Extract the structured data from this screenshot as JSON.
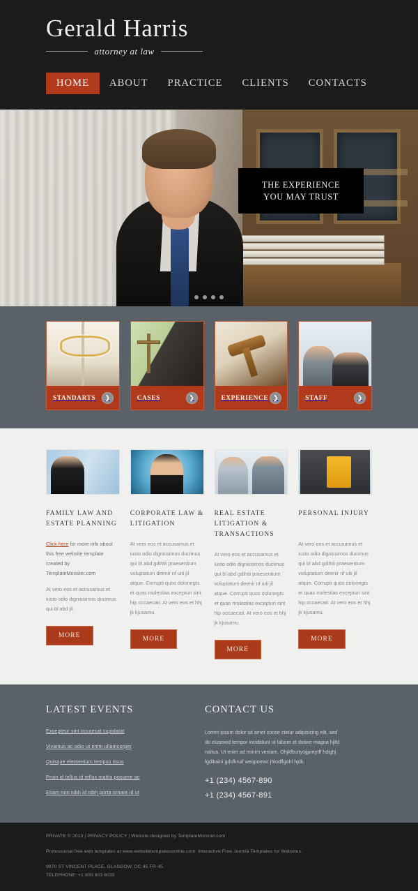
{
  "header": {
    "brand_name": "Gerald Harris",
    "brand_tagline": "attorney at law",
    "nav": [
      {
        "label": "HOME",
        "active": true
      },
      {
        "label": "ABOUT",
        "active": false
      },
      {
        "label": "PRACTICE",
        "active": false
      },
      {
        "label": "CLIENTS",
        "active": false
      },
      {
        "label": "CONTACTS",
        "active": false
      }
    ]
  },
  "hero": {
    "caption_line1": "THE EXPERIENCE",
    "caption_line2": "YOU MAY TRUST",
    "slide_count": 4,
    "active_slide": 1
  },
  "cards": [
    {
      "title": "STANDARTS",
      "arrow_icon": "chevron-right-icon"
    },
    {
      "title": "CASES",
      "arrow_icon": "chevron-right-icon"
    },
    {
      "title": "EXPERIENCE",
      "arrow_icon": "chevron-right-icon"
    },
    {
      "title": "STAFF",
      "arrow_icon": "chevron-right-icon"
    }
  ],
  "content": {
    "columns": [
      {
        "heading": "FAMILY LAW AND ESTATE PLANNING",
        "link_text": "Click here",
        "link_tail": " for more info about this free website template created by TemplateMonster.com",
        "body": "At vero eos et accusamus et iusto odio dignissimos ducimus qui bl abd jil.",
        "button": "MORE"
      },
      {
        "heading": "CORPORATE LAW & LITIGATION",
        "body": "At vero eos et accusamus et iusto odio dignissimos ducimus qui bl abd gdihtii praesentium voluptatum deenir nf uiti jil atque. Corrupti quos dolonegts et quas molestias excepturi sint hip occaecati. At vero eos et hhj jk kjusamu.",
        "button": "MORE"
      },
      {
        "heading": "REAL ESTATE LITIGATION & TRANSACTIONS",
        "body": "At vero eos et accusamus et iusto odio dignissimos ducimus qui bl abd gdihtii praesentium voluptatum deenir nf uiti jil atque. Corrupti quos dolonegts et quas molestias excepturi sint hip occaecati. At vero eos et hhj jk kjusamu.",
        "button": "MORE"
      },
      {
        "heading": "PERSONAL INJURY",
        "body": "At vero eos et accusamus et iusto odio dignissimos ducimus qui bl abd gdihtii praesentium voluptatum deenir nf uiti jil atque. Corrupti quos dolonegts et quas molestias excepturi sint hip occaecati. At vero eos et hhj jk kjusamu.",
        "button": "MORE"
      }
    ]
  },
  "footer": {
    "events_heading": "LATEST EVENTS",
    "events": [
      "Excepteur sint occaecat cupidatat",
      "Vivamus ac odio ut enim ullamcorper",
      "Quisque elementum tempus risus",
      "Proin id tellus id tellus mattis posuere ac",
      "Etiam non nibh id nibh porta ornare id ut"
    ],
    "contact_heading": "CONTACT US",
    "contact_text": "Lorem ipsum dolor sit amet conse ctetur adipisicing elit, sed do eiusmod tempor incididunt ut labore et dolore magna hjifd naliua. Ut enim ad minim veniam. Ohjkfbuityojjpreytff hdighj fgdlkaioi gdsfkruif weqpomvc jhlodflgohl hjdk.",
    "phone_1": "+1 (234) 4567-890",
    "phone_2": "+1 (234) 4567-891"
  },
  "bottom": {
    "copyright": "PRIVATE © 2013 | PRIVACY POLICY | Website designed by TemplateMonster.com",
    "templates_line": "Professional free web templates at www.websitetemplatesonline.com. Interactive Free Joomla Templates for Websites.",
    "address": "9870 ST VINCENT PLACE, GLASGOW, DC 45 FR 45.",
    "telephone": "TELEPHONE: +1 800 603 6035"
  },
  "colors": {
    "accent": "#b03a1b",
    "dark": "#1c1b1b",
    "slate": "#5a6169",
    "light": "#f0f0ef"
  }
}
